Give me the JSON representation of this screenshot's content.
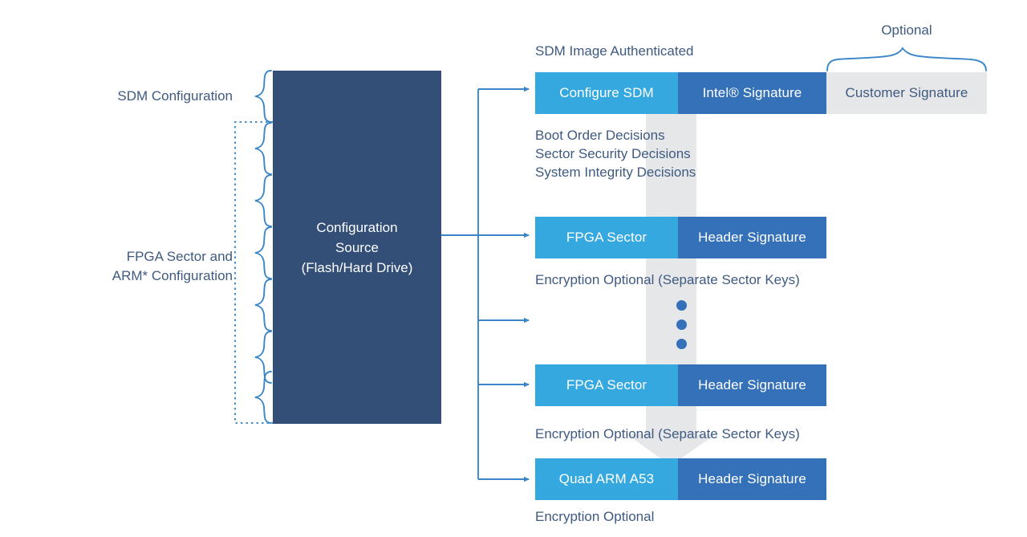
{
  "diagram": {
    "title": "SDM and FPGA Sector Configuration Flow",
    "colors": {
      "navy": "#334E77",
      "primary_blue": "#35A8E0",
      "secondary_blue": "#3571B8",
      "optional_gray": "#E6E7E8",
      "text_blue": "#3F5A80",
      "connector_blue": "#3A86C8"
    }
  },
  "left": {
    "brackets": [
      {
        "label": "SDM Configuration"
      },
      {
        "label": "FPGA Sector and\nARM* Configuration"
      }
    ],
    "config_source": {
      "label": "Configuration\nSource\n(Flash/Hard Drive)"
    }
  },
  "right": {
    "optional_brace_label": "Optional",
    "rows": [
      {
        "name": "sdm-image",
        "caption_above": "SDM Image Authenticated",
        "segments": [
          {
            "label": "Configure SDM",
            "style": "primary"
          },
          {
            "label": "Intel® Signature",
            "style": "secondary"
          },
          {
            "label": "Customer Signature",
            "style": "optional"
          }
        ],
        "caption_below": "Boot Order Decisions\nSector Security Decisions\nSystem Integrity Decisions"
      },
      {
        "name": "fpga-sector-1",
        "segments": [
          {
            "label": "FPGA Sector",
            "style": "primary"
          },
          {
            "label": "Header Signature",
            "style": "secondary"
          }
        ],
        "caption_below": "Encryption Optional (Separate Sector Keys)"
      },
      {
        "name": "fpga-sector-2",
        "segments": [
          {
            "label": "FPGA Sector",
            "style": "primary"
          },
          {
            "label": "Header Signature",
            "style": "secondary"
          }
        ],
        "caption_below": "Encryption Optional (Separate Sector Keys)"
      },
      {
        "name": "quad-arm-a53",
        "segments": [
          {
            "label": "Quad ARM A53",
            "style": "primary"
          },
          {
            "label": "Header Signature",
            "style": "secondary"
          }
        ],
        "caption_below": "Encryption Optional"
      }
    ],
    "ellipsis_dot_count": 3
  }
}
